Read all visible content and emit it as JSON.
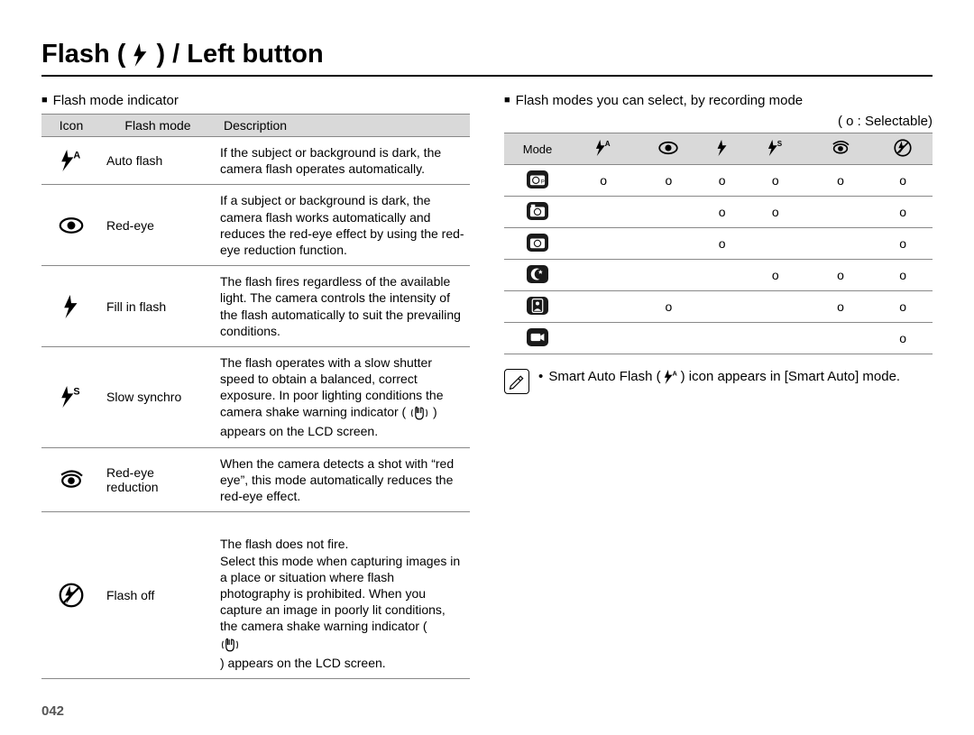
{
  "title_prefix": "Flash (",
  "title_suffix": ") / Left button",
  "left": {
    "heading": "Flash mode indicator",
    "cols": [
      "Icon",
      "Flash mode",
      "Description"
    ],
    "rows": [
      {
        "mode": "Auto flash",
        "desc": "If the subject or background is dark, the camera flash operates automatically."
      },
      {
        "mode": "Red-eye",
        "desc": "If a subject or background is dark, the camera flash works automatically and reduces the red-eye effect by using the red-eye reduction function."
      },
      {
        "mode": "Fill in flash",
        "desc": "The flash fires regardless of the available light. The camera controls the intensity of the flash automatically to suit the prevailing conditions."
      },
      {
        "mode": "Slow synchro",
        "desc_pre": "The flash operates with a slow shutter speed to obtain a balanced, correct exposure. In poor lighting conditions the camera shake warning indicator (",
        "desc_post": ") appears on the LCD screen."
      },
      {
        "mode": "Red-eye reduction",
        "desc": "When the camera detects a shot with “red eye”, this mode automatically reduces the red-eye effect."
      },
      {
        "mode": "Flash off",
        "desc_pre": "The flash does not fire.\nSelect this mode when capturing images in a place or situation where flash photography is prohibited. When you capture an image in poorly lit conditions, the camera shake warning indicator (",
        "desc_post": ") appears on the LCD screen."
      }
    ]
  },
  "right": {
    "heading": "Flash modes you can select, by recording mode",
    "legend": "( o : Selectable)",
    "mode_label": "Mode",
    "grid": [
      [
        "o",
        "o",
        "o",
        "o",
        "o",
        "o"
      ],
      [
        "",
        "",
        "o",
        "o",
        "",
        "o"
      ],
      [
        "",
        "",
        "o",
        "",
        "",
        "o"
      ],
      [
        "",
        "",
        "",
        "o",
        "o",
        "o"
      ],
      [
        "",
        "o",
        "",
        "",
        "o",
        "o"
      ],
      [
        "",
        "",
        "",
        "",
        "",
        "o"
      ]
    ],
    "note_pre": "Smart Auto Flash (",
    "note_post": ") icon appears in [Smart Auto] mode."
  },
  "page_number": "042"
}
